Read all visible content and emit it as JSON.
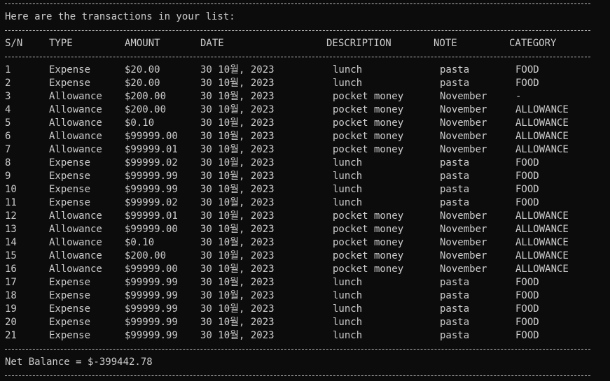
{
  "intro": "Here are the transactions in your list:",
  "headers": {
    "sn": "S/N",
    "type": "TYPE",
    "amount": "AMOUNT",
    "date": "DATE",
    "description": "DESCRIPTION",
    "note": "NOTE",
    "category": "CATEGORY"
  },
  "transactions": [
    {
      "sn": "1",
      "type": "Expense",
      "amount": "$20.00",
      "date": "30 10월, 2023",
      "description": "lunch",
      "note": "pasta",
      "category": "FOOD"
    },
    {
      "sn": "2",
      "type": "Expense",
      "amount": "$20.00",
      "date": "30 10월, 2023",
      "description": "lunch",
      "note": "pasta",
      "category": "FOOD"
    },
    {
      "sn": "3",
      "type": "Allowance",
      "amount": "$200.00",
      "date": "30 10월, 2023",
      "description": "pocket money",
      "note": "November",
      "category": "-"
    },
    {
      "sn": "4",
      "type": "Allowance",
      "amount": "$200.00",
      "date": "30 10월, 2023",
      "description": "pocket money",
      "note": "November",
      "category": "ALLOWANCE"
    },
    {
      "sn": "5",
      "type": "Allowance",
      "amount": "$0.10",
      "date": "30 10월, 2023",
      "description": "pocket money",
      "note": "November",
      "category": "ALLOWANCE"
    },
    {
      "sn": "6",
      "type": "Allowance",
      "amount": "$99999.00",
      "date": "30 10월, 2023",
      "description": "pocket money",
      "note": "November",
      "category": "ALLOWANCE"
    },
    {
      "sn": "7",
      "type": "Allowance",
      "amount": "$99999.01",
      "date": "30 10월, 2023",
      "description": "pocket money",
      "note": "November",
      "category": "ALLOWANCE"
    },
    {
      "sn": "8",
      "type": "Expense",
      "amount": "$99999.02",
      "date": "30 10월, 2023",
      "description": "lunch",
      "note": "pasta",
      "category": "FOOD"
    },
    {
      "sn": "9",
      "type": "Expense",
      "amount": "$99999.99",
      "date": "30 10월, 2023",
      "description": "lunch",
      "note": "pasta",
      "category": "FOOD"
    },
    {
      "sn": "10",
      "type": "Expense",
      "amount": "$99999.99",
      "date": "30 10월, 2023",
      "description": "lunch",
      "note": "pasta",
      "category": "FOOD"
    },
    {
      "sn": "11",
      "type": "Expense",
      "amount": "$99999.02",
      "date": "30 10월, 2023",
      "description": "lunch",
      "note": "pasta",
      "category": "FOOD"
    },
    {
      "sn": "12",
      "type": "Allowance",
      "amount": "$99999.01",
      "date": "30 10월, 2023",
      "description": "pocket money",
      "note": "November",
      "category": "ALLOWANCE"
    },
    {
      "sn": "13",
      "type": "Allowance",
      "amount": "$99999.00",
      "date": "30 10월, 2023",
      "description": "pocket money",
      "note": "November",
      "category": "ALLOWANCE"
    },
    {
      "sn": "14",
      "type": "Allowance",
      "amount": "$0.10",
      "date": "30 10월, 2023",
      "description": "pocket money",
      "note": "November",
      "category": "ALLOWANCE"
    },
    {
      "sn": "15",
      "type": "Allowance",
      "amount": "$200.00",
      "date": "30 10월, 2023",
      "description": "pocket money",
      "note": "November",
      "category": "ALLOWANCE"
    },
    {
      "sn": "16",
      "type": "Allowance",
      "amount": "$99999.00",
      "date": "30 10월, 2023",
      "description": "pocket money",
      "note": "November",
      "category": "ALLOWANCE"
    },
    {
      "sn": "17",
      "type": "Expense",
      "amount": "$99999.99",
      "date": "30 10월, 2023",
      "description": "lunch",
      "note": "pasta",
      "category": "FOOD"
    },
    {
      "sn": "18",
      "type": "Expense",
      "amount": "$99999.99",
      "date": "30 10월, 2023",
      "description": "lunch",
      "note": "pasta",
      "category": "FOOD"
    },
    {
      "sn": "19",
      "type": "Expense",
      "amount": "$99999.99",
      "date": "30 10월, 2023",
      "description": "lunch",
      "note": "pasta",
      "category": "FOOD"
    },
    {
      "sn": "20",
      "type": "Expense",
      "amount": "$99999.99",
      "date": "30 10월, 2023",
      "description": "lunch",
      "note": "pasta",
      "category": "FOOD"
    },
    {
      "sn": "21",
      "type": "Expense",
      "amount": "$99999.99",
      "date": "30 10월, 2023",
      "description": "lunch",
      "note": "pasta",
      "category": "FOOD"
    }
  ],
  "net_balance": "Net Balance = $-399442.78",
  "colors": {
    "background": "#0c0c0c",
    "text": "#cccccc"
  }
}
